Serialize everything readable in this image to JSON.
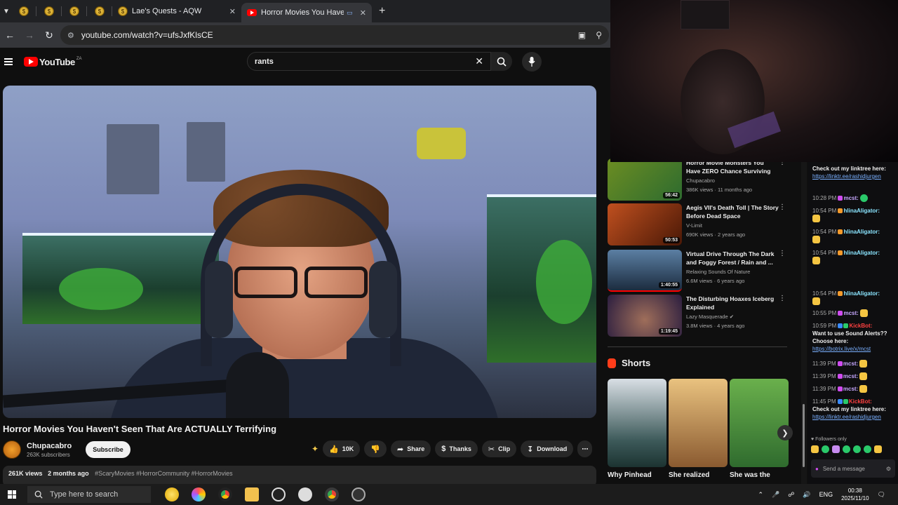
{
  "browser": {
    "pinned_tabs": [
      "",
      "",
      "",
      ""
    ],
    "tabs": [
      {
        "title": "Lae's Quests - AQW"
      },
      {
        "title": "Horror Movies You Haven't"
      }
    ],
    "url": "youtube.com/watch?v=ufsJxfKlsCE"
  },
  "youtube": {
    "logo_text": "YouTube",
    "logo_region": "ZA",
    "search_value": "rants"
  },
  "video": {
    "title": "Horror Movies You Haven't Seen That Are ACTUALLY Terrifying",
    "channel": "Chupacabro",
    "subscribers": "263K subscribers",
    "subscribe_label": "Subscribe",
    "likes": "10K",
    "share": "Share",
    "thanks": "Thanks",
    "clip": "Clip",
    "download": "Download",
    "views": "261K views",
    "age": "2 months ago",
    "hashtags": "#ScaryMovies #HorrorCommunity #HorrorMovies"
  },
  "recommendations": [
    {
      "title": "Horror Movie Monsters You Have ZERO Chance Surviving |...",
      "channel": "Chupacabro",
      "meta": "386K views · 11 months ago",
      "duration": "56:42",
      "thumb_color": "#2d6b2f"
    },
    {
      "title": "Aegis VII's Death Toll | The Story Before Dead Space",
      "channel": "V-Limit",
      "meta": "690K views · 2 years ago",
      "duration": "50:53",
      "thumb_color": "#7a2a10"
    },
    {
      "title": "Virtual Drive Through The Dark and Foggy Forest / Rain and ...",
      "channel": "Relaxing Sounds Of Nature",
      "meta": "6.6M views · 6 years ago",
      "duration": "1:40:55",
      "thumb_color": "#23344a"
    },
    {
      "title": "The Disturbing Hoaxes Iceberg Explained",
      "channel": "Lazy Masquerade",
      "meta": "3.8M views · 4 years ago",
      "duration": "1:19:45",
      "thumb_color": "#3b2a5a"
    }
  ],
  "shorts": {
    "heading": "Shorts",
    "items": [
      {
        "title": "Why Pinhead",
        "color": "#4d5a6a"
      },
      {
        "title": "She realized",
        "color": "#b89060"
      },
      {
        "title": "She was the",
        "color": "#4f8a44"
      }
    ]
  },
  "chat": {
    "lines": [
      {
        "time": "",
        "user": "",
        "text": "Check out my linktree here:",
        "link": "https://linktr.ee/rashidjurgen"
      },
      {
        "time": "10:28 PM",
        "user": "mcst:",
        "text": ""
      },
      {
        "time": "10:54 PM",
        "user": "hlinaAligator:",
        "text": ""
      },
      {
        "time": "10:54 PM",
        "user": "hlinaAligator:",
        "text": ""
      },
      {
        "time": "10:54 PM",
        "user": "hlinaAligator:",
        "text": ""
      },
      {
        "time": "10:54 PM",
        "user": "hlinaAligator:",
        "text": ""
      },
      {
        "time": "10:55 PM",
        "user": "mcst:",
        "text": ""
      },
      {
        "time": "10:59 PM",
        "user": "KickBot:",
        "text": "Want to use Sound Alerts?? Choose here:",
        "link": "https://botrix.live/x/mcst"
      },
      {
        "time": "11:39 PM",
        "user": "mcst:",
        "text": ""
      },
      {
        "time": "11:39 PM",
        "user": "mcst:",
        "text": ""
      },
      {
        "time": "11:39 PM",
        "user": "mcst:",
        "text": ""
      },
      {
        "time": "11:45 PM",
        "user": "KickBot:",
        "text": "Check out my linktree here:",
        "link": "https://linktr.ee/rashidjurgen"
      }
    ],
    "followers_only": "Followers only",
    "input_placeholder": "Send a message"
  },
  "taskbar": {
    "search_placeholder": "Type here to search",
    "lang": "ENG",
    "time": "00:38",
    "date": "2025/11/10"
  }
}
